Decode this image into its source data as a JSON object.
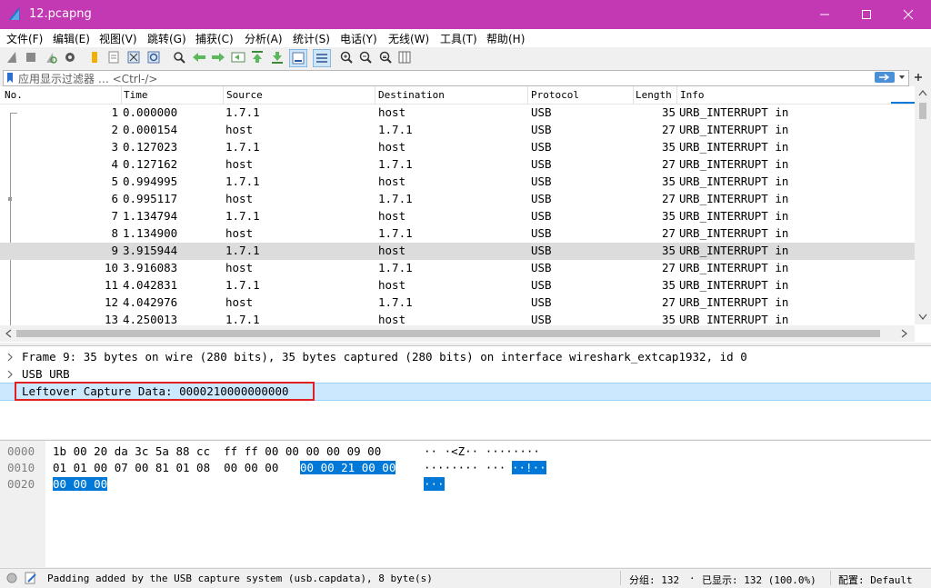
{
  "window": {
    "title": "12.pcapng"
  },
  "menu": [
    "文件(F)",
    "编辑(E)",
    "视图(V)",
    "跳转(G)",
    "捕获(C)",
    "分析(A)",
    "统计(S)",
    "电话(Y)",
    "无线(W)",
    "工具(T)",
    "帮助(H)"
  ],
  "filter": {
    "placeholder": "应用显示过滤器 … <Ctrl-/>"
  },
  "columns": {
    "no": "No.",
    "time": "Time",
    "source": "Source",
    "destination": "Destination",
    "protocol": "Protocol",
    "length": "Length",
    "info": "Info"
  },
  "packets": [
    {
      "no": "1",
      "time": "0.000000",
      "src": "1.7.1",
      "dst": "host",
      "proto": "USB",
      "len": "35",
      "info": "URB_INTERRUPT in"
    },
    {
      "no": "2",
      "time": "0.000154",
      "src": "host",
      "dst": "1.7.1",
      "proto": "USB",
      "len": "27",
      "info": "URB_INTERRUPT in"
    },
    {
      "no": "3",
      "time": "0.127023",
      "src": "1.7.1",
      "dst": "host",
      "proto": "USB",
      "len": "35",
      "info": "URB_INTERRUPT in"
    },
    {
      "no": "4",
      "time": "0.127162",
      "src": "host",
      "dst": "1.7.1",
      "proto": "USB",
      "len": "27",
      "info": "URB_INTERRUPT in"
    },
    {
      "no": "5",
      "time": "0.994995",
      "src": "1.7.1",
      "dst": "host",
      "proto": "USB",
      "len": "35",
      "info": "URB_INTERRUPT in"
    },
    {
      "no": "6",
      "time": "0.995117",
      "src": "host",
      "dst": "1.7.1",
      "proto": "USB",
      "len": "27",
      "info": "URB_INTERRUPT in"
    },
    {
      "no": "7",
      "time": "1.134794",
      "src": "1.7.1",
      "dst": "host",
      "proto": "USB",
      "len": "35",
      "info": "URB_INTERRUPT in"
    },
    {
      "no": "8",
      "time": "1.134900",
      "src": "host",
      "dst": "1.7.1",
      "proto": "USB",
      "len": "27",
      "info": "URB_INTERRUPT in"
    },
    {
      "no": "9",
      "time": "3.915944",
      "src": "1.7.1",
      "dst": "host",
      "proto": "USB",
      "len": "35",
      "info": "URB_INTERRUPT in"
    },
    {
      "no": "10",
      "time": "3.916083",
      "src": "host",
      "dst": "1.7.1",
      "proto": "USB",
      "len": "27",
      "info": "URB_INTERRUPT in"
    },
    {
      "no": "11",
      "time": "4.042831",
      "src": "1.7.1",
      "dst": "host",
      "proto": "USB",
      "len": "35",
      "info": "URB_INTERRUPT in"
    },
    {
      "no": "12",
      "time": "4.042976",
      "src": "host",
      "dst": "1.7.1",
      "proto": "USB",
      "len": "27",
      "info": "URB_INTERRUPT in"
    },
    {
      "no": "13",
      "time": "4.250013",
      "src": "1.7.1",
      "dst": "host",
      "proto": "USB",
      "len": "35",
      "info": "URB_INTERRUPT in"
    }
  ],
  "selected_packet": "9",
  "details": [
    "Frame 9: 35 bytes on wire (280 bits), 35 bytes captured (280 bits) on interface wireshark_extcap1932, id 0",
    "USB URB",
    "Leftover Capture Data: 0000210000000000"
  ],
  "bytes": [
    {
      "offset": "0000",
      "hex": "1b 00 20 da 3c 5a 88 cc  ff ff 00 00 00 00 09 00",
      "hex_hl": "",
      "ascii": "·· ·<Z·· ········",
      "ascii_hl": ""
    },
    {
      "offset": "0010",
      "hex": "01 01 00 07 00 81 01 08  00 00 00 ",
      "hex_hl": "00 00 21 00 00",
      "ascii": "········ ···",
      "ascii_hl": "··!··"
    },
    {
      "offset": "0020",
      "hex": "",
      "hex_hl": "00 00 00",
      "ascii": "",
      "ascii_hl": "···"
    }
  ],
  "status": {
    "message": "Padding added by the USB capture system (usb.capdata), 8 byte(s)",
    "packets": "分组: 132",
    "displayed": "已显示: 132 (100.0%)",
    "profile": "配置: Default"
  },
  "colors": {
    "titlebar": "#c239b3",
    "selection": "#0078d7",
    "highlight_row": "#cce8ff",
    "annotation_box": "#e02020"
  }
}
